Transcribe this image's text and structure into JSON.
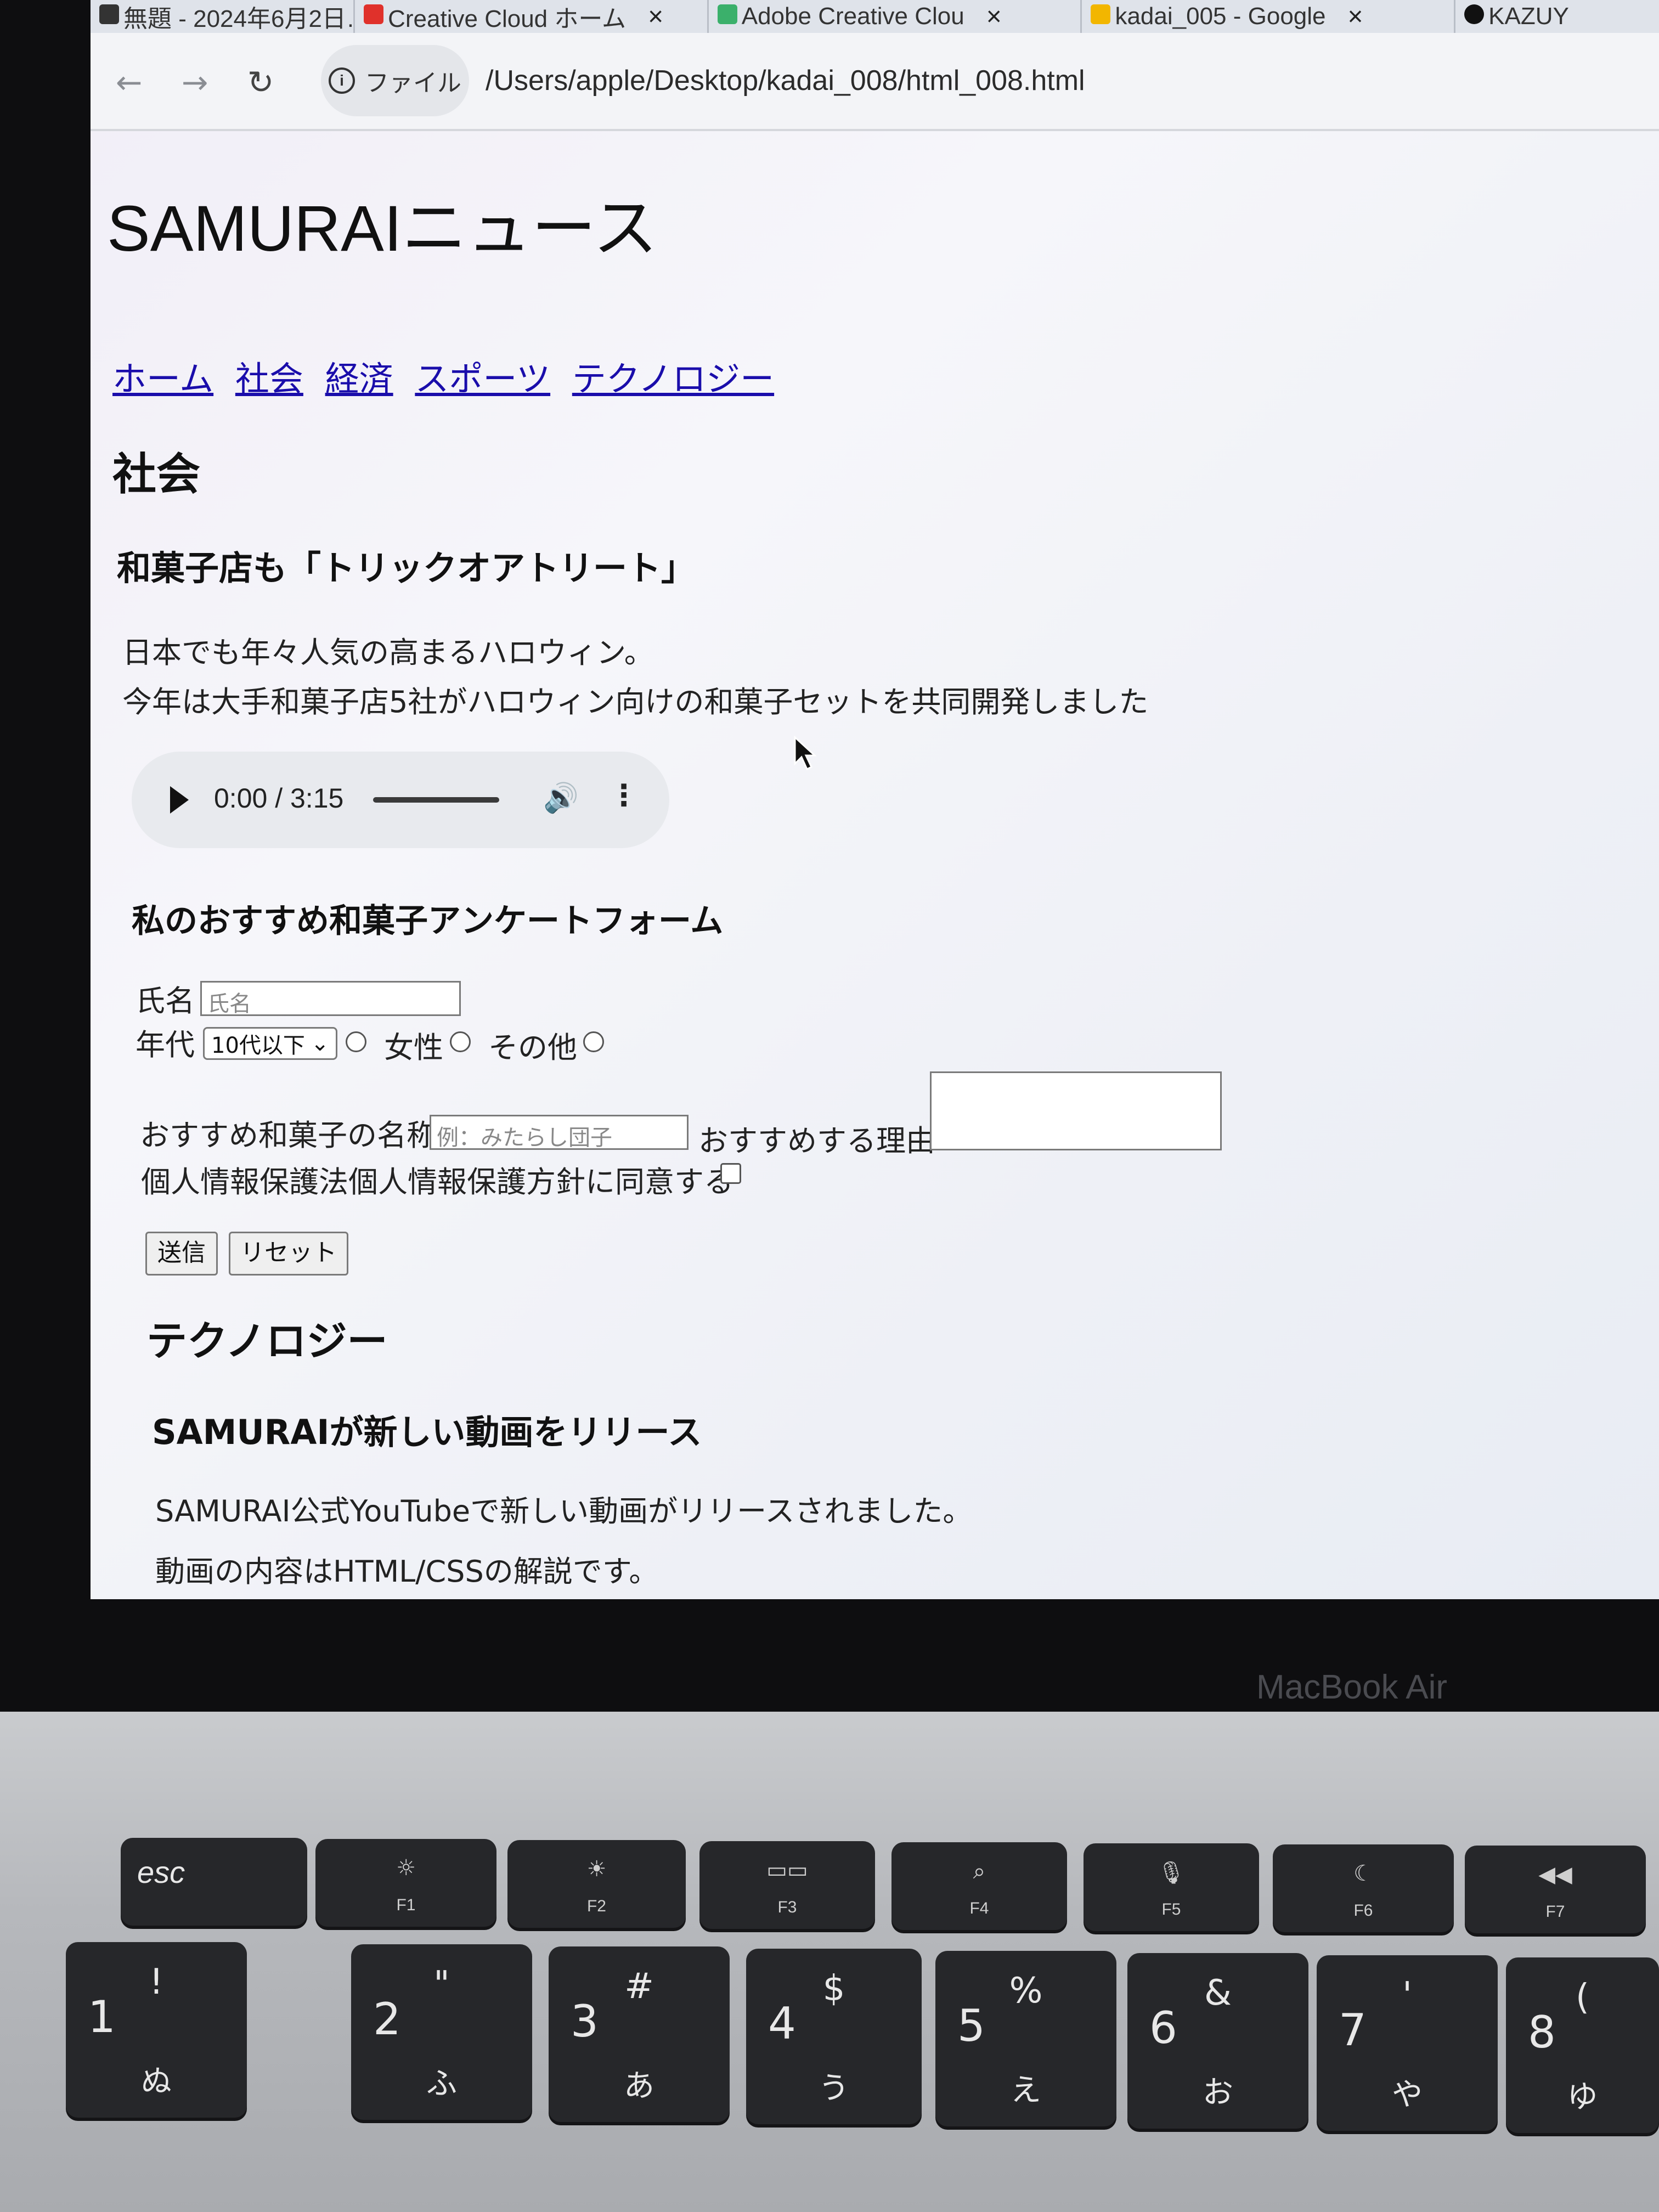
{
  "browser": {
    "tabs": [
      {
        "title": "無題 - 2024年6月2日…",
        "close": "×",
        "color": "#333333"
      },
      {
        "title": "Creative Cloud ホーム",
        "close": "×",
        "color": "#e0312b"
      },
      {
        "title": "Adobe Creative Clou",
        "close": "×",
        "color": "#3bb06b"
      },
      {
        "title": "kadai_005 - Google",
        "close": "×",
        "color": "#f2b600"
      },
      {
        "title": "KAZUY",
        "close": "",
        "color": "#111111"
      }
    ],
    "back": "←",
    "forward": "→",
    "reload": "↻",
    "site_chip": "ファイル",
    "url": "/Users/apple/Desktop/kadai_008/html_008.html"
  },
  "page": {
    "title": "SAMURAIニュース",
    "nav": [
      "ホーム",
      "社会",
      "経済",
      "スポーツ",
      "テクノロジー"
    ],
    "society": {
      "heading": "社会",
      "article_title": "和菓子店も「トリックオアトリート」",
      "lines": [
        "日本でも年々人気の高まるハロウィン。",
        "今年は大手和菓子店5社がハロウィン向けの和菓子セットを共同開発しました"
      ],
      "audio": {
        "time": "0:00 / 3:15",
        "progress": 0
      }
    },
    "form": {
      "heading": "私のおすすめ和菓子アンケートフォーム",
      "name_label": "氏名",
      "name_placeholder": "氏名",
      "age_label": "年代",
      "age_selected": "10代以下",
      "gender_options": [
        "",
        "女性",
        "その他"
      ],
      "sweet_label": "おすすめ和菓子の名称",
      "sweet_placeholder": "例：みたらし団子",
      "reason_label": "おすすめする理由",
      "consent_label": "個人情報保護法個人情報保護方針に同意する",
      "submit": "送信",
      "reset": "リセット"
    },
    "technology": {
      "heading": "テクノロジー",
      "article_title": "SAMURAIが新しい動画をリリース",
      "line1": "SAMURAI公式YouTubeで新しい動画がリリースされました。",
      "line2": "動画の内容はHTML/CSSの解説です。"
    }
  },
  "laptop": {
    "brand": "MacBook Air",
    "fn_keys": [
      {
        "label": "esc",
        "icon": ""
      },
      {
        "label": "F1",
        "icon": "☼"
      },
      {
        "label": "F2",
        "icon": "☀"
      },
      {
        "label": "F3",
        "icon": "▭▭"
      },
      {
        "label": "F4",
        "icon": "⌕"
      },
      {
        "label": "F5",
        "icon": "🎙"
      },
      {
        "label": "F6",
        "icon": "☾"
      },
      {
        "label": "F7",
        "icon": "◀◀"
      }
    ],
    "num_keys": [
      {
        "num": "1",
        "sym": "!",
        "kana": "ぬ"
      },
      {
        "num": "2",
        "sym": "\"",
        "kana": "ふ"
      },
      {
        "num": "3",
        "sym": "#",
        "kana": "あ"
      },
      {
        "num": "4",
        "sym": "$",
        "kana": "う"
      },
      {
        "num": "5",
        "sym": "%",
        "kana": "え"
      },
      {
        "num": "6",
        "sym": "&",
        "kana": "お"
      },
      {
        "num": "7",
        "sym": "'",
        "kana": "や"
      },
      {
        "num": "8",
        "sym": "(",
        "kana": "ゆ"
      }
    ]
  }
}
